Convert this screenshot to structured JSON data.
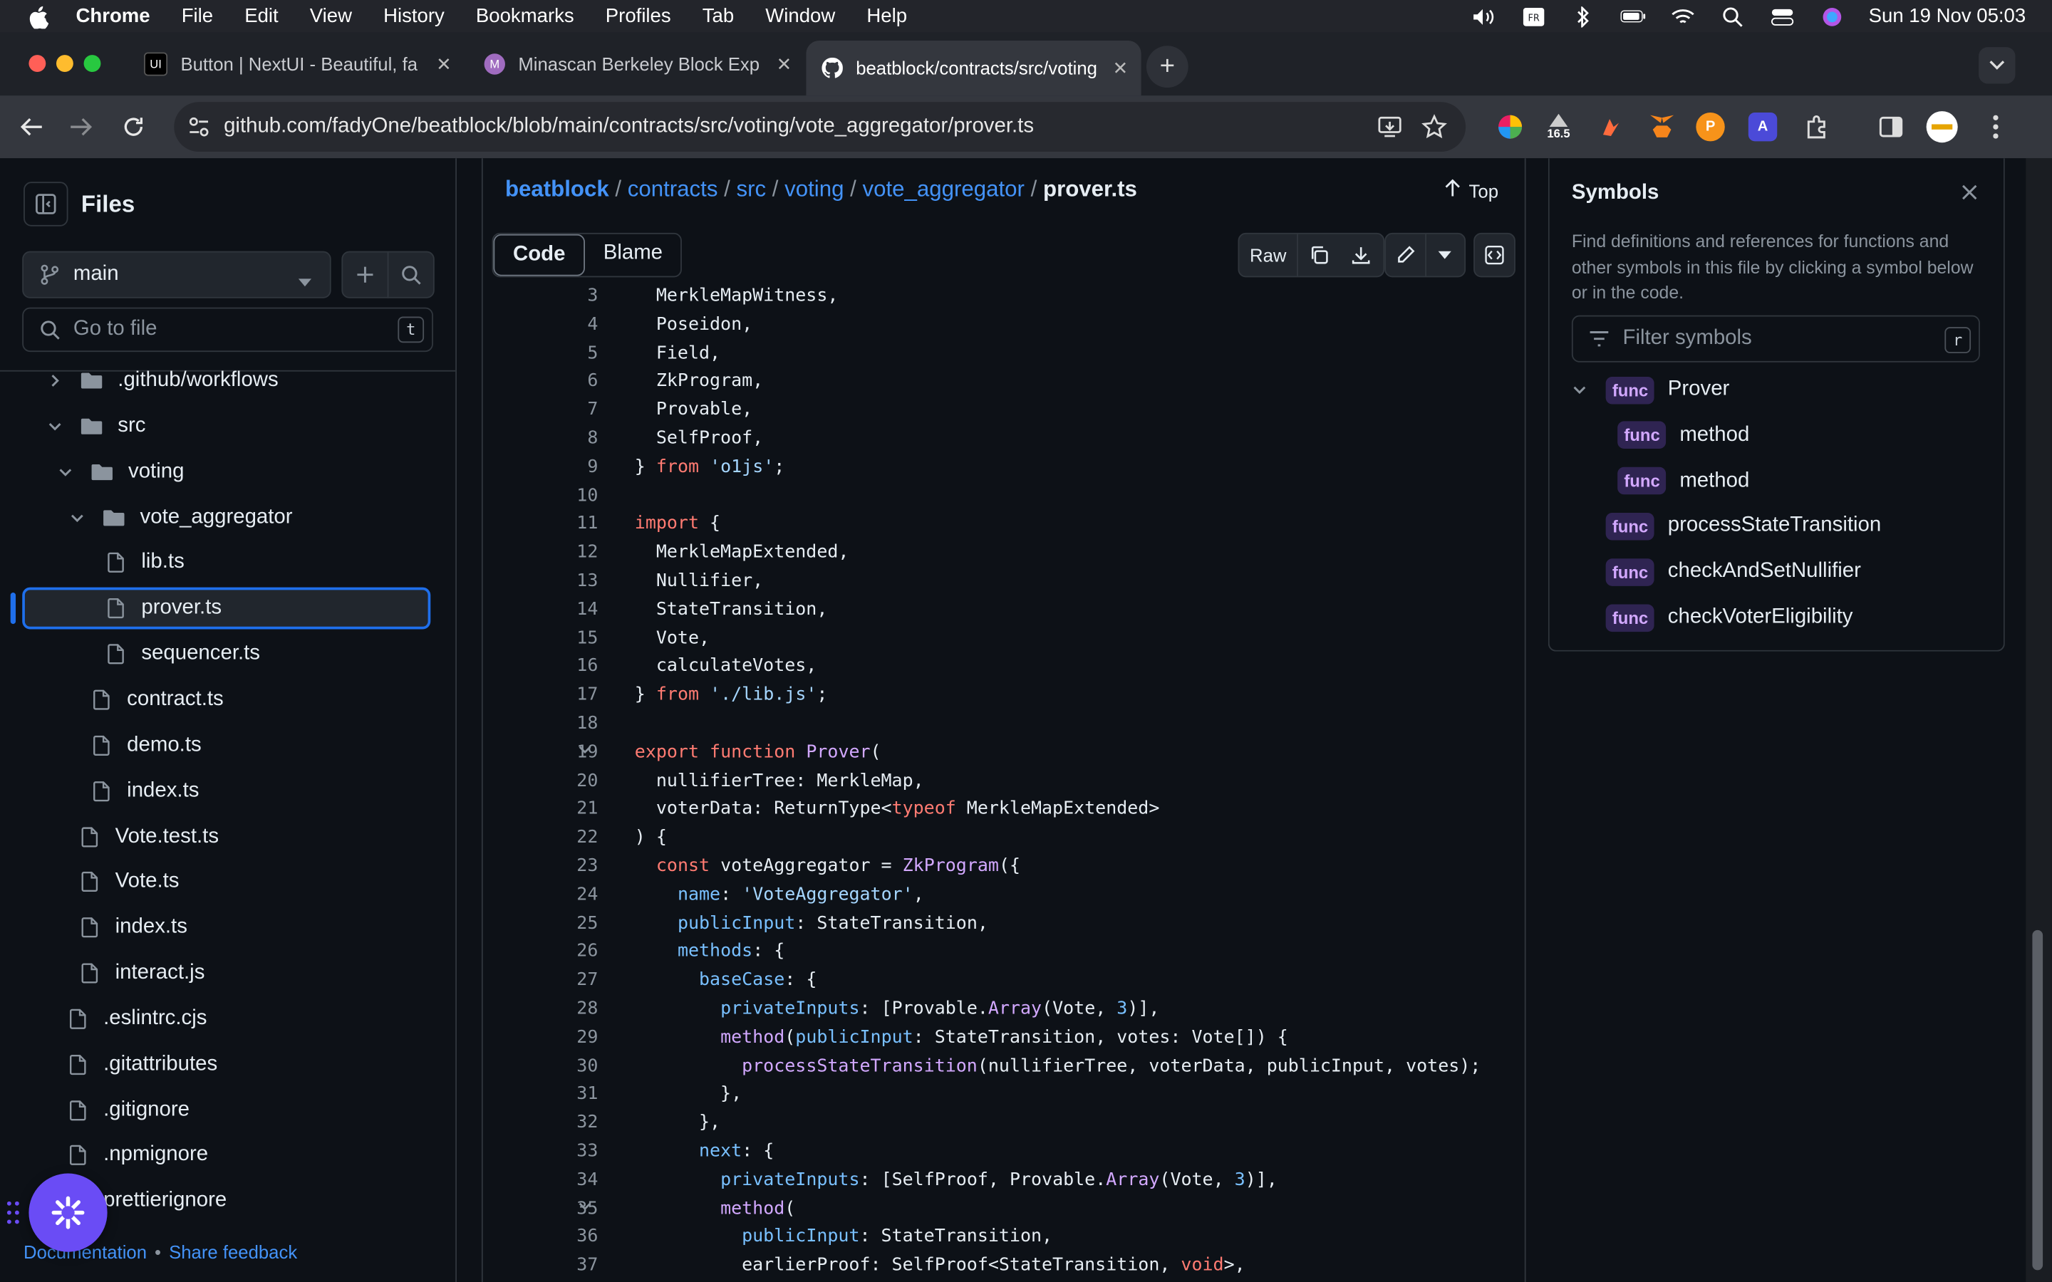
{
  "menubar": {
    "app": "Chrome",
    "items": [
      "File",
      "Edit",
      "View",
      "History",
      "Bookmarks",
      "Profiles",
      "Tab",
      "Window",
      "Help"
    ],
    "datetime": "Sun 19 Nov  05:03"
  },
  "tabs": [
    {
      "title": "Button | NextUI - Beautiful, fa",
      "icon": "nextui-icon"
    },
    {
      "title": "Minascan Berkeley Block Expl",
      "icon": "minascan-icon"
    },
    {
      "title": "beatblock/contracts/src/voting",
      "icon": "github-icon"
    }
  ],
  "address_bar": {
    "url": "github.com/fadyOne/beatblock/blob/main/contracts/src/voting/vote_aggregator/prover.ts"
  },
  "extensions": {
    "badge_value": "16.5"
  },
  "files_panel": {
    "title": "Files",
    "branch": "main",
    "goto_placeholder": "Go to file",
    "goto_shortcut": "t",
    "tree": [
      {
        "label": ".github/workflows",
        "type": "folder",
        "expanded": false
      },
      {
        "label": "src",
        "type": "folder",
        "expanded": true
      },
      {
        "label": "voting",
        "type": "folder",
        "expanded": true
      },
      {
        "label": "vote_aggregator",
        "type": "folder",
        "expanded": true
      },
      {
        "label": "lib.ts",
        "type": "file"
      },
      {
        "label": "prover.ts",
        "type": "file",
        "selected": true
      },
      {
        "label": "sequencer.ts",
        "type": "file"
      },
      {
        "label": "contract.ts",
        "type": "file"
      },
      {
        "label": "demo.ts",
        "type": "file"
      },
      {
        "label": "index.ts",
        "type": "file"
      },
      {
        "label": "Vote.test.ts",
        "type": "file"
      },
      {
        "label": "Vote.ts",
        "type": "file"
      },
      {
        "label": "index.ts",
        "type": "file"
      },
      {
        "label": "interact.js",
        "type": "file"
      },
      {
        "label": ".eslintrc.cjs",
        "type": "file"
      },
      {
        "label": ".gitattributes",
        "type": "file"
      },
      {
        "label": ".gitignore",
        "type": "file"
      },
      {
        "label": ".npmignore",
        "type": "file"
      },
      {
        "label": "prettierignore",
        "type": "file"
      }
    ],
    "footer": {
      "docs": "Documentation",
      "sep": "•",
      "feedback": "Share feedback"
    }
  },
  "breadcrumbs": [
    "beatblock",
    "contracts",
    "src",
    "voting",
    "vote_aggregator"
  ],
  "breadcrumb_current": "prover.ts",
  "top_label": "Top",
  "code_tabs": {
    "code": "Code",
    "blame": "Blame"
  },
  "raw_label": "Raw",
  "code": [
    {
      "n": "3",
      "t": "  MerkleMapWitness,"
    },
    {
      "n": "4",
      "t": "  Poseidon,"
    },
    {
      "n": "5",
      "t": "  Field,"
    },
    {
      "n": "6",
      "t": "  ZkProgram,"
    },
    {
      "n": "7",
      "t": "  Provable,"
    },
    {
      "n": "8",
      "t": "  SelfProof,"
    },
    {
      "n": "9",
      "t": "} from 'o1js';"
    },
    {
      "n": "10",
      "t": ""
    },
    {
      "n": "11",
      "t": "import {"
    },
    {
      "n": "12",
      "t": "  MerkleMapExtended,"
    },
    {
      "n": "13",
      "t": "  Nullifier,"
    },
    {
      "n": "14",
      "t": "  StateTransition,"
    },
    {
      "n": "15",
      "t": "  Vote,"
    },
    {
      "n": "16",
      "t": "  calculateVotes,"
    },
    {
      "n": "17",
      "t": "} from './lib.js';"
    },
    {
      "n": "18",
      "t": ""
    },
    {
      "n": "19",
      "t": "export function Prover(",
      "fold": true
    },
    {
      "n": "20",
      "t": "  nullifierTree: MerkleMap,"
    },
    {
      "n": "21",
      "t": "  voterData: ReturnType<typeof MerkleMapExtended>"
    },
    {
      "n": "22",
      "t": ") {"
    },
    {
      "n": "23",
      "t": "  const voteAggregator = ZkProgram({"
    },
    {
      "n": "24",
      "t": "    name: 'VoteAggregator',"
    },
    {
      "n": "25",
      "t": "    publicInput: StateTransition,"
    },
    {
      "n": "26",
      "t": "    methods: {"
    },
    {
      "n": "27",
      "t": "      baseCase: {"
    },
    {
      "n": "28",
      "t": "        privateInputs: [Provable.Array(Vote, 3)],"
    },
    {
      "n": "29",
      "t": "        method(publicInput: StateTransition, votes: Vote[]) {"
    },
    {
      "n": "30",
      "t": "          processStateTransition(nullifierTree, voterData, publicInput, votes);"
    },
    {
      "n": "31",
      "t": "        },"
    },
    {
      "n": "32",
      "t": "      },"
    },
    {
      "n": "33",
      "t": "      next: {"
    },
    {
      "n": "34",
      "t": "        privateInputs: [SelfProof, Provable.Array(Vote, 3)],"
    },
    {
      "n": "35",
      "t": "        method(",
      "fold": true
    },
    {
      "n": "36",
      "t": "          publicInput: StateTransition,"
    },
    {
      "n": "37",
      "t": "          earlierProof: SelfProof<StateTransition, void>,"
    }
  ],
  "symbols": {
    "title": "Symbols",
    "description": "Find definitions and references for functions and other symbols in this file by clicking a symbol below or in the code.",
    "filter_placeholder": "Filter symbols",
    "filter_shortcut": "r",
    "badge": "func",
    "items": [
      {
        "name": "Prover",
        "level": 0,
        "expanded": true
      },
      {
        "name": "method",
        "level": 1
      },
      {
        "name": "method",
        "level": 1
      },
      {
        "name": "processStateTransition",
        "level": 0
      },
      {
        "name": "checkAndSetNullifier",
        "level": 0
      },
      {
        "name": "checkVoterEligibility",
        "level": 0
      }
    ]
  }
}
